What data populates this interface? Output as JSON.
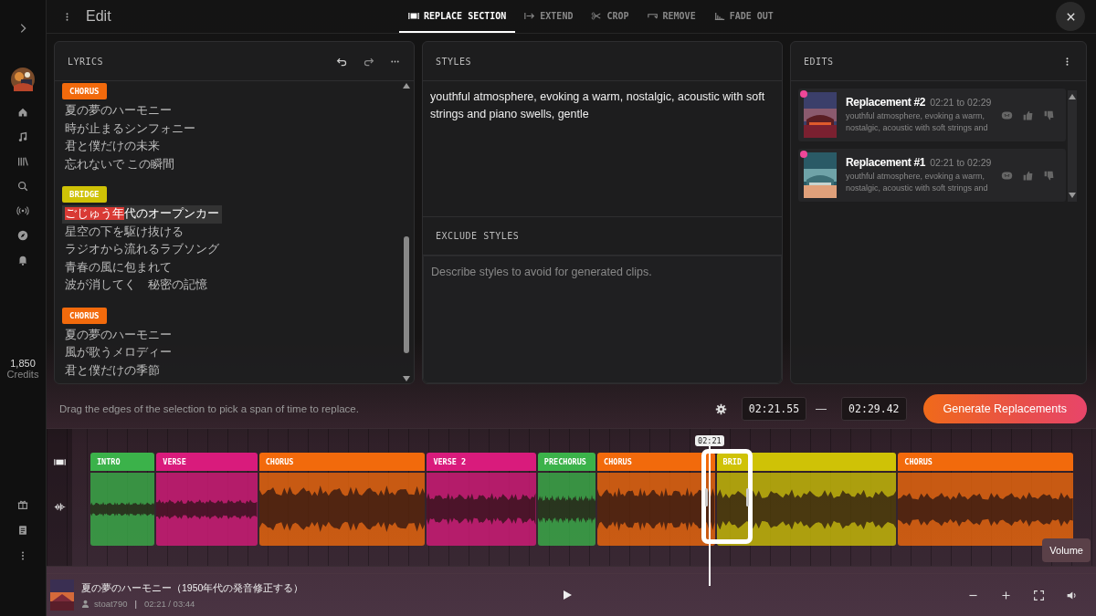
{
  "header": {
    "title": "Edit"
  },
  "tabs": [
    {
      "label": "REPLACE SECTION",
      "selected": true
    },
    {
      "label": "EXTEND",
      "selected": false
    },
    {
      "label": "CROP",
      "selected": false
    },
    {
      "label": "REMOVE",
      "selected": false
    },
    {
      "label": "FADE OUT",
      "selected": false
    }
  ],
  "sidebar": {
    "credits": "1,850",
    "credits_label": "Credits"
  },
  "lyrics": {
    "title": "LYRICS",
    "sections": [
      {
        "tag": "CHORUS",
        "color": "#f26a0c",
        "lines": [
          {
            "text": "夏の夢のハーモニー"
          },
          {
            "text": "時が止まるシンフォニー"
          },
          {
            "text": "君と僕だけの未来"
          },
          {
            "text": "忘れないで この瞬間"
          }
        ]
      },
      {
        "tag": "BRIDGE",
        "color": "#cfc206",
        "lines": [
          {
            "marked": "ごじゅう年",
            "text": "代のオープンカー"
          },
          {
            "text": "星空の下を駆け抜ける"
          },
          {
            "text": "ラジオから流れるラブソング"
          },
          {
            "text": "青春の風に包まれて"
          },
          {
            "text": "波が消してく　秘密の記憶"
          }
        ]
      },
      {
        "tag": "CHORUS",
        "color": "#f26a0c",
        "lines": [
          {
            "text": "夏の夢のハーモニー"
          },
          {
            "text": "風が歌うメロディー"
          },
          {
            "text": "君と僕だけの季節"
          }
        ]
      }
    ]
  },
  "styles": {
    "title": "STYLES",
    "value": "youthful atmosphere, evoking a warm, nostalgic, acoustic with soft strings and piano swells, gentle"
  },
  "exclude_styles": {
    "title": "EXCLUDE STYLES",
    "placeholder": "Describe styles to avoid for generated clips."
  },
  "edits": {
    "title": "EDITS",
    "items": [
      {
        "title": "Replacement #2",
        "range": "02:21 to 02:29",
        "description": "youthful atmosphere, evoking a warm, nostalgic, acoustic with soft strings and",
        "color": "#ee4799"
      },
      {
        "title": "Replacement #1",
        "range": "02:21 to 02:29",
        "description": "youthful atmosphere, evoking a warm, nostalgic, acoustic with soft strings and",
        "color": "#ee4799"
      }
    ]
  },
  "selection_bar": {
    "hint": "Drag the edges of the selection to pick a span of time to replace.",
    "start": "02:21.55",
    "separator": "—",
    "end": "02:29.42",
    "generate_button": "Generate Replacements"
  },
  "timeline": {
    "playhead_time": "02:21",
    "tooltip": "Volume",
    "sections": [
      {
        "label": "INTRO",
        "color": "#3bb24a"
      },
      {
        "label": "VERSE",
        "color": "#d91b7c"
      },
      {
        "label": "CHORUS",
        "color": "#f26a0c"
      },
      {
        "label": "VERSE 2",
        "color": "#d91b7c"
      },
      {
        "label": "PRECHORUS",
        "color": "#3bb24a"
      },
      {
        "label": "CHORUS",
        "color": "#f26a0c"
      },
      {
        "label": "BRID",
        "color": "#cfc206"
      },
      {
        "label": "CHORUS",
        "color": "#f26a0c"
      }
    ]
  },
  "player": {
    "title": "夏の夢のハーモニー（1950年代の発音修正する）",
    "user": "stoat790",
    "separator": "|",
    "time": "02:21 / 03:44"
  }
}
